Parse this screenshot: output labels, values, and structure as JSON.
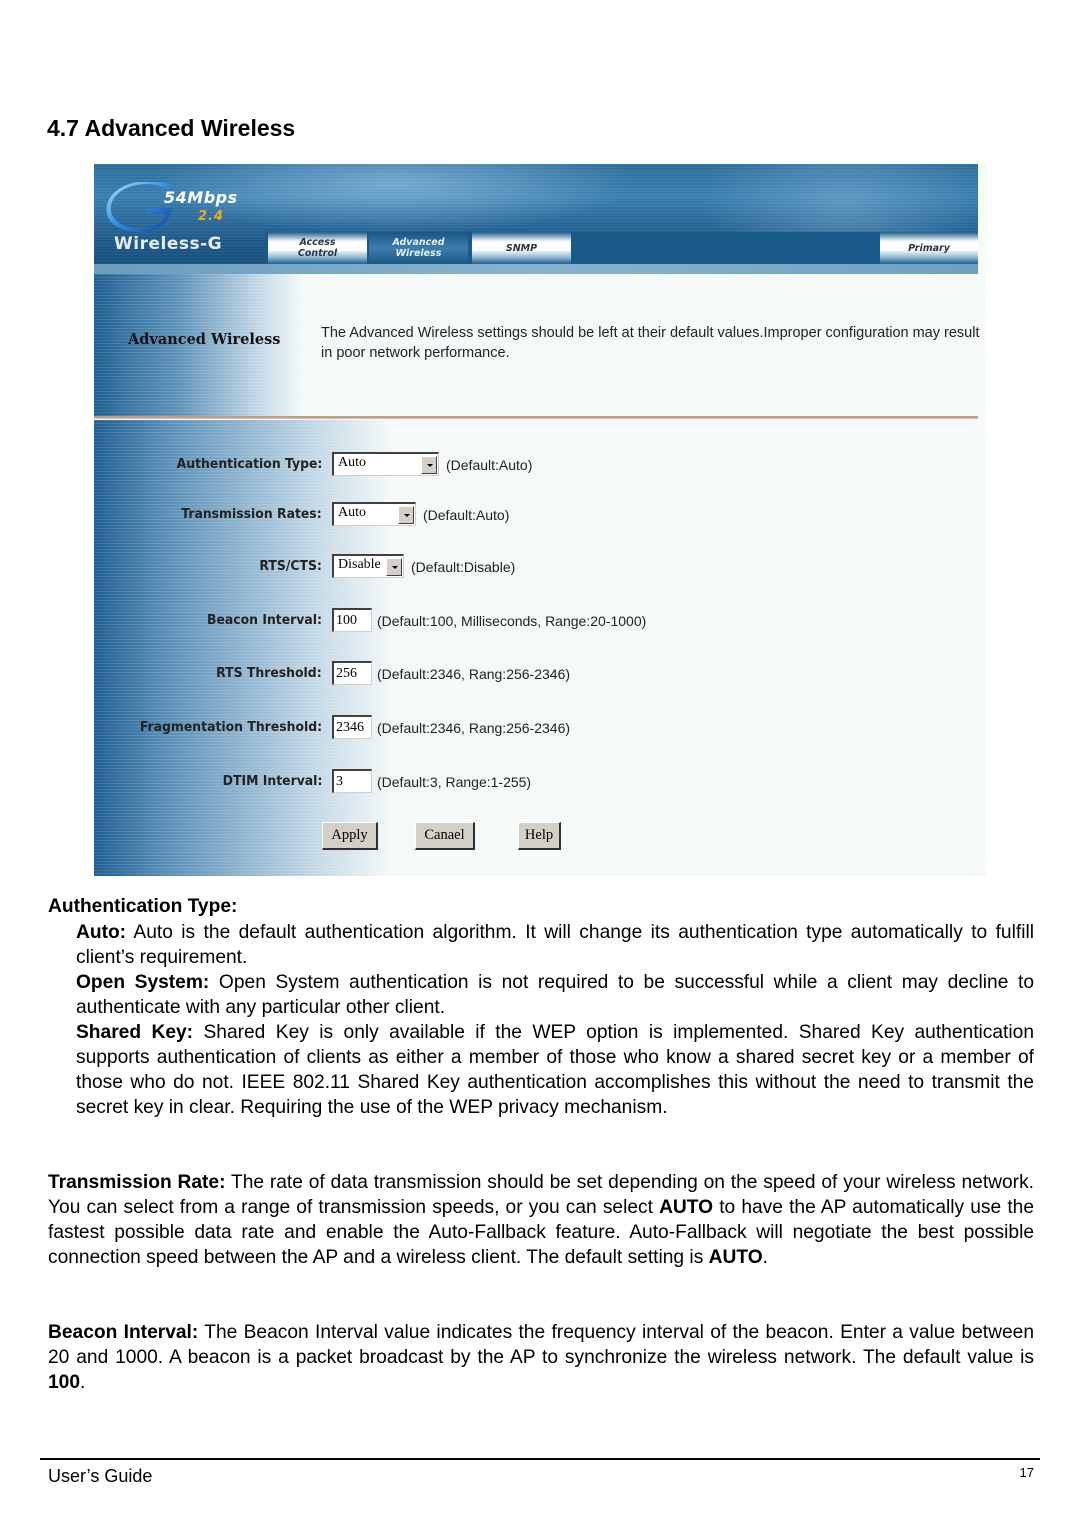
{
  "document": {
    "section_title": "4.7 Advanced Wireless",
    "footer": {
      "left": "User’s Guide",
      "page_number": "17"
    }
  },
  "screenshot": {
    "logo": {
      "icon": "g-logo-icon",
      "speed": "54Mbps",
      "frequency": "2.4",
      "product": "Wireless-G"
    },
    "nav_tabs": [
      {
        "label_line1": "Access",
        "label_line2": "Control",
        "active": false
      },
      {
        "label_line1": "Advanced",
        "label_line2": "Wireless",
        "active": true
      },
      {
        "label_line1": "SNMP",
        "label_line2": "",
        "active": false
      },
      {
        "label_line1": "Primary",
        "label_line2": "",
        "active": false
      }
    ],
    "panel_heading": "Advanced Wireless",
    "panel_description": "The Advanced Wireless settings should be left at their default values.Improper configuration may result in poor network performance.",
    "form": {
      "authentication_type": {
        "label": "Authentication Type:",
        "value": "Auto",
        "hint": "(Default:Auto)"
      },
      "transmission_rates": {
        "label": "Transmission Rates:",
        "value": "Auto",
        "hint": "(Default:Auto)"
      },
      "rts_cts": {
        "label": "RTS/CTS:",
        "value": "Disable",
        "hint": "(Default:Disable)"
      },
      "beacon_interval": {
        "label": "Beacon Interval:",
        "value": "100",
        "hint": "(Default:100, Milliseconds, Range:20-1000)"
      },
      "rts_threshold": {
        "label": "RTS Threshold:",
        "value": "256",
        "hint": "(Default:2346, Rang:256-2346)"
      },
      "fragmentation_threshold": {
        "label": "Fragmentation Threshold:",
        "value": "2346",
        "hint": "(Default:2346, Rang:256-2346)"
      },
      "dtim_interval": {
        "label": "DTIM Interval:",
        "value": "3",
        "hint": "(Default:3, Range:1-255)"
      }
    },
    "buttons": {
      "apply": "Apply",
      "cancel": "Canael",
      "help": "Help"
    }
  },
  "body": {
    "auth_heading": "Authentication Type:",
    "auto": {
      "term": "Auto:",
      "text": " Auto is the default authentication algorithm. It will change its authentication type automatically to fulfill client’s requirement."
    },
    "open_system": {
      "term": "Open System:",
      "text": " Open System authentication is not required to be successful while a client may decline to authenticate with any particular other client."
    },
    "shared_key": {
      "term": "Shared Key:",
      "text": " Shared Key is only available if the WEP option is implemented. Shared Key authentication supports authentication of clients as either a member of those who know a shared secret key or a member of those who do not. IEEE 802.11 Shared Key authentication accomplishes this without the need to transmit the secret key in clear. Requiring the use of the WEP privacy mechanism."
    },
    "transmission_rate": {
      "term": "Transmission Rate:",
      "text1": " The rate of data transmission should be set depending on the speed of your wireless network. You can select from a range of transmission speeds, or you can select ",
      "bold1": "AUTO",
      "text2": " to have the AP automatically use the fastest possible data rate and enable the Auto-Fallback feature. Auto-Fallback will negotiate the best possible connection speed between the AP and a wireless client. The default setting is ",
      "bold2": "AUTO",
      "text3": "."
    },
    "beacon_interval": {
      "term": "Beacon Interval:",
      "text1": " The Beacon Interval value indicates the frequency interval of the beacon. Enter a value between 20 and 1000. A beacon is a packet broadcast by the AP to synchronize the wireless network. The default value is ",
      "bold1": "100",
      "text2": "."
    }
  }
}
